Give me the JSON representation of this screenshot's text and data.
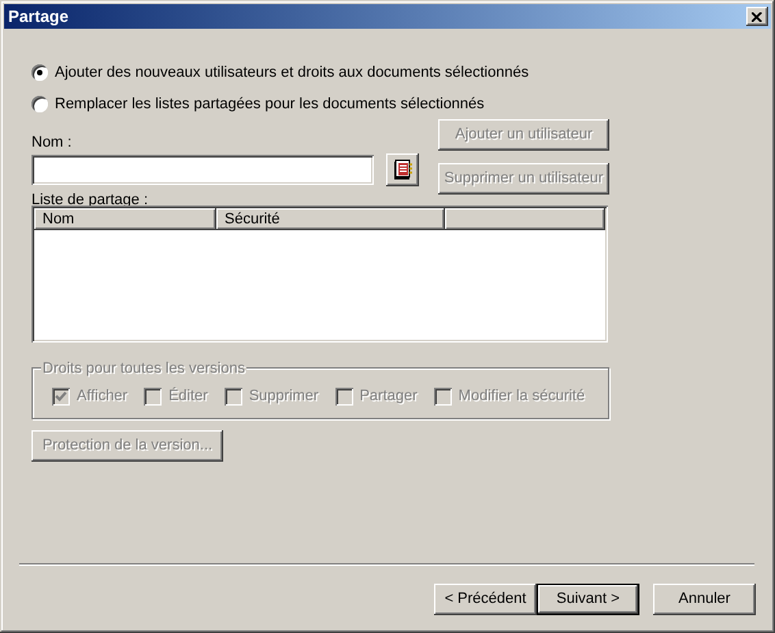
{
  "window": {
    "title": "Partage"
  },
  "radios": [
    {
      "label": "Ajouter des nouveaux utilisateurs et droits aux documents sélectionnés",
      "selected": true
    },
    {
      "label": "Remplacer les listes partagées pour les documents sélectionnés",
      "selected": false
    }
  ],
  "name_field": {
    "label": "Nom :"
  },
  "user_buttons": [
    {
      "label": "Ajouter un utilisateur",
      "disabled": true
    },
    {
      "label": "Supprimer un utilisateur",
      "disabled": true
    }
  ],
  "share_list": {
    "label": "Liste de partage :",
    "columns": [
      "Nom",
      "Sécurité"
    ]
  },
  "rights": {
    "title": "Droits pour toutes les versions",
    "disabled": true,
    "checkboxes": [
      {
        "label": "Afficher",
        "checked": true
      },
      {
        "label": "Éditer",
        "checked": false
      },
      {
        "label": "Supprimer",
        "checked": false
      },
      {
        "label": "Partager",
        "checked": false
      },
      {
        "label": "Modifier la sécurité",
        "checked": false
      }
    ]
  },
  "protection_button": {
    "label": "Protection de la version...",
    "disabled": true
  },
  "footer_buttons": [
    {
      "label": "< Précédent",
      "default": false
    },
    {
      "label": "Suivant >",
      "default": true
    },
    {
      "label": "Annuler",
      "default": false
    }
  ]
}
